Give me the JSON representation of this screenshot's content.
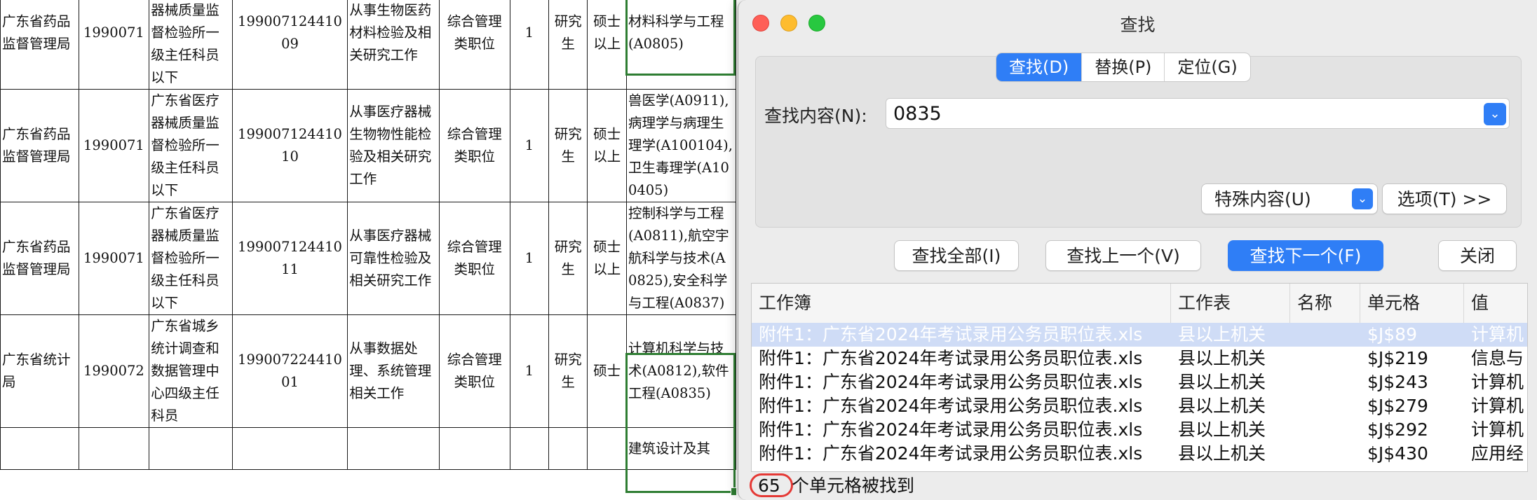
{
  "sheet": {
    "rows": [
      {
        "dept": "广东省药品监督管理局",
        "code": "1990071",
        "unit": "广东省医疗器械质量监督检验所一级主任科员以下",
        "post_code": "19900712441009",
        "duty": "从事生物医药材料检验及相关研究工作",
        "category": "综合管理类职位",
        "num": "1",
        "edu": "研究生",
        "degree": "硕士以上",
        "major": "材料科学与工程(A0805)"
      },
      {
        "dept": "广东省药品监督管理局",
        "code": "1990071",
        "unit": "广东省医疗器械质量监督检验所一级主任科员以下",
        "post_code": "19900712441010",
        "duty": "从事医疗器械生物物性能检验及相关研究工作",
        "category": "综合管理类职位",
        "num": "1",
        "edu": "研究生",
        "degree": "硕士以上",
        "major": "兽医学(A0911),病理学与病理生理学(A100104),卫生毒理学(A100405)"
      },
      {
        "dept": "广东省药品监督管理局",
        "code": "1990071",
        "unit": "广东省医疗器械质量监督检验所一级主任科员以下",
        "post_code": "19900712441011",
        "duty": "从事医疗器械可靠性检验及相关研究工作",
        "category": "综合管理类职位",
        "num": "1",
        "edu": "研究生",
        "degree": "硕士以上",
        "major": "控制科学与工程(A0811),航空宇航科学与技术(A0825),安全科学与工程(A0837)"
      },
      {
        "dept": "广东省统计局",
        "code": "1990072",
        "unit": "广东省城乡统计调查和数据管理中心四级主任科员",
        "post_code": "19900722441001",
        "duty": "从事数据处理、系统管理相关工作",
        "category": "综合管理类职位",
        "num": "1",
        "edu": "研究生",
        "degree": "硕士",
        "major": "计算机科学与技术(A0812),软件工程(A0835)"
      },
      {
        "dept": "",
        "code": "",
        "unit": "",
        "post_code": "",
        "duty": "",
        "category": "",
        "num": "",
        "edu": "",
        "degree": "",
        "major": "建筑设计及其"
      }
    ]
  },
  "dialog": {
    "title": "查找",
    "tabs": [
      "查找(D)",
      "替换(P)",
      "定位(G)"
    ],
    "active_tab": 0,
    "find_label": "查找内容(N):",
    "find_value": "0835",
    "special_label": "特殊内容(U)",
    "options_label": "选项(T) >>",
    "buttons": {
      "find_all": "查找全部(I)",
      "find_prev": "查找上一个(V)",
      "find_next": "查找下一个(F)",
      "close": "关闭"
    },
    "results": {
      "headers": [
        "工作簿",
        "工作表",
        "名称",
        "单元格",
        "值"
      ],
      "rows": [
        {
          "workbook": "附件1：广东省2024年考试录用公务员职位表.xls",
          "sheet": "县以上机关",
          "name": "",
          "cell": "$J$89",
          "value": "计算机"
        },
        {
          "workbook": "附件1：广东省2024年考试录用公务员职位表.xls",
          "sheet": "县以上机关",
          "name": "",
          "cell": "$J$219",
          "value": "信息与"
        },
        {
          "workbook": "附件1：广东省2024年考试录用公务员职位表.xls",
          "sheet": "县以上机关",
          "name": "",
          "cell": "$J$243",
          "value": "计算机"
        },
        {
          "workbook": "附件1：广东省2024年考试录用公务员职位表.xls",
          "sheet": "县以上机关",
          "name": "",
          "cell": "$J$279",
          "value": "计算机"
        },
        {
          "workbook": "附件1：广东省2024年考试录用公务员职位表.xls",
          "sheet": "县以上机关",
          "name": "",
          "cell": "$J$292",
          "value": "计算机"
        },
        {
          "workbook": "附件1：广东省2024年考试录用公务员职位表.xls",
          "sheet": "县以上机关",
          "name": "",
          "cell": "$J$430",
          "value": "应用经"
        }
      ]
    },
    "status_count": "65",
    "status_text": "个单元格被找到"
  },
  "colors": {
    "accent": "#2f7ef6",
    "selection_green": "#2e7d32",
    "highlight_ring": "#e53935"
  }
}
